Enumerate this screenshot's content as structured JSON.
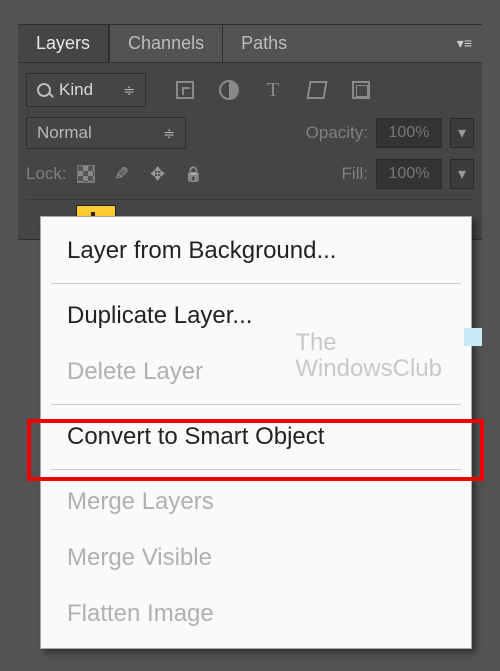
{
  "tabs": {
    "layers": "Layers",
    "channels": "Channels",
    "paths": "Paths"
  },
  "filter": {
    "kind": "Kind"
  },
  "blend": {
    "mode": "Normal",
    "opacity_label": "Opacity:",
    "opacity_value": "100%"
  },
  "lock": {
    "label": "Lock:",
    "fill_label": "Fill:",
    "fill_value": "100%"
  },
  "menu": {
    "layer_from_bg": "Layer from Background...",
    "duplicate": "Duplicate Layer...",
    "delete": "Delete Layer",
    "convert": "Convert to Smart Object",
    "merge_layers": "Merge Layers",
    "merge_visible": "Merge Visible",
    "flatten": "Flatten Image"
  },
  "watermark": {
    "line1": "The",
    "line2": "WindowsClub"
  }
}
